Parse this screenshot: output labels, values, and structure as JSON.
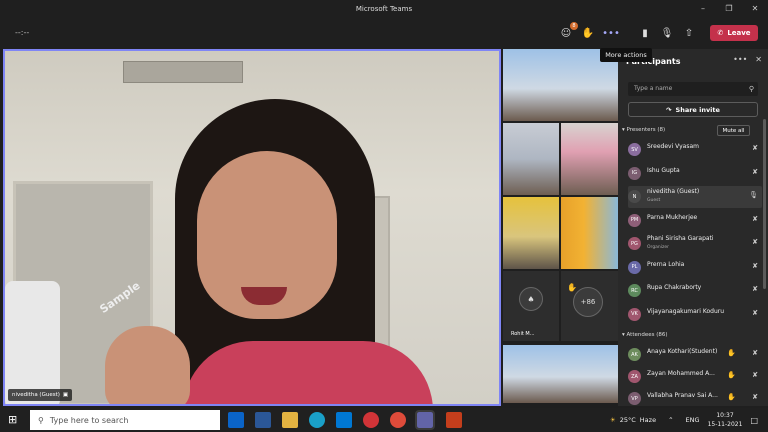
{
  "window": {
    "title": "Microsoft Teams"
  },
  "toolbar": {
    "timer": "--:--",
    "participants_badge": "8",
    "leave_label": "Leave",
    "tooltip": "More actions"
  },
  "main_video": {
    "name_tag": "niveditha (Guest)",
    "watermark": "Sample"
  },
  "grid": {
    "avatar_tile_label": "Rohit M...",
    "overflow_count": "+86"
  },
  "panel": {
    "title": "Participants",
    "search_placeholder": "Type a name",
    "share_invite": "Share invite",
    "presenters_header": "Presenters (8)",
    "mute_all": "Mute all",
    "presenters": [
      {
        "initials": "SV",
        "name": "Sreedevi Vyasam",
        "role": "",
        "color": "#8a6d9e"
      },
      {
        "initials": "IG",
        "name": "Ishu Gupta",
        "role": "",
        "color": "#7b5d70"
      },
      {
        "initials": "N",
        "name": "niveditha (Guest)",
        "role": "Guest",
        "color": "#4a4a4a"
      },
      {
        "initials": "PM",
        "name": "Parna Mukherjee",
        "role": "",
        "color": "#8e5f78"
      },
      {
        "initials": "PG",
        "name": "Phani Sirisha Garapati",
        "role": "Organizer",
        "color": "#a0566e"
      },
      {
        "initials": "PL",
        "name": "Prerna Lohia",
        "role": "",
        "color": "#6a6aa8"
      },
      {
        "initials": "RC",
        "name": "Rupa Chakraborty",
        "role": "",
        "color": "#5d8a5d"
      },
      {
        "initials": "VK",
        "name": "Vijayanagakumari Koduru",
        "role": "",
        "color": "#a0566e"
      }
    ],
    "attendees_header": "Attendees (86)",
    "attendees": [
      {
        "initials": "AK",
        "name": "Anaya Kothari(Student)",
        "color": "#6d8c5d"
      },
      {
        "initials": "ZA",
        "name": "Zayan Mohammed A...",
        "color": "#a0566e"
      },
      {
        "initials": "VP",
        "name": "Vallabha Pranav Sai A...",
        "color": "#7b5d70"
      }
    ]
  },
  "taskbar": {
    "search_placeholder": "Type here to search",
    "weather": "25°C",
    "weather_label": "Haze",
    "language": "ENG",
    "time": "10:37",
    "date": "15-11-2021"
  }
}
